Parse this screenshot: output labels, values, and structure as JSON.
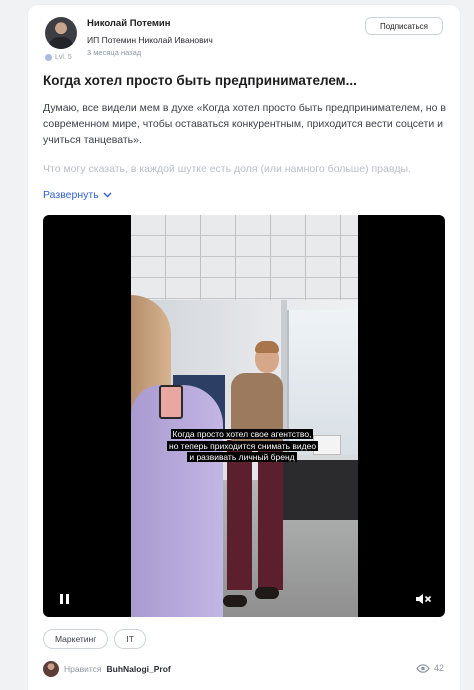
{
  "author": {
    "name": "Николай Потемин",
    "subtitle": "ИП Потемин Николай Иванович",
    "time": "3 месяца назад",
    "level": "Lvl. 5"
  },
  "subscribe_label": "Подписаться",
  "post": {
    "title": "Когда хотел просто быть предпринимателем...",
    "body": "Думаю, все видели мем в духе «Когда хотел просто быть предпринимателем, но в современном мире, чтобы оставаться конкурентным, приходится вести соцсети и учиться танцевать».",
    "faded": "Что могу сказать, в каждой шутке есть доля (или намного больше) правды.",
    "expand_label": "Развернуть"
  },
  "video": {
    "caption": "Когда просто хотел свое агентство, но теперь приходится снимать видео и развивать личный бренд"
  },
  "tags": [
    "Маркетинг",
    "IT"
  ],
  "footer": {
    "likes_prefix": "Нравится",
    "likes_user": "BuhNalogi_Prof",
    "views": "42"
  },
  "icons": {
    "expand": "chevron-down-icon",
    "pause": "pause-icon",
    "mute": "volume-muted-icon",
    "views": "eye-icon"
  },
  "colors": {
    "accent": "#2f5fd0",
    "muted": "#8e96a3"
  }
}
